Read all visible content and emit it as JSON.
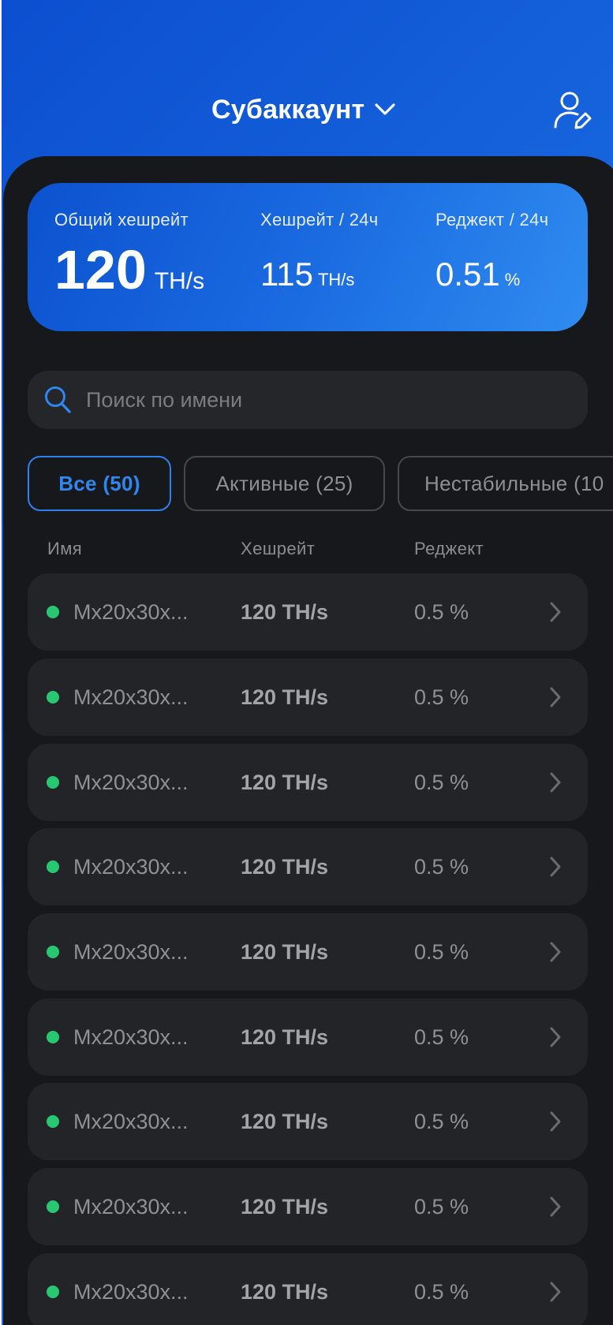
{
  "header": {
    "title": "Субаккаунт"
  },
  "stats": {
    "total": {
      "label": "Общий хешрейт",
      "value": "120",
      "unit": "TH/s"
    },
    "hashrate24": {
      "label": "Хешрейт / 24ч",
      "value": "115",
      "unit": "TH/s"
    },
    "reject24": {
      "label": "Реджект / 24ч",
      "value": "0.51",
      "unit": "%"
    }
  },
  "search": {
    "placeholder": "Поиск по имени"
  },
  "tabs": [
    {
      "label": "Все (50)",
      "active": true
    },
    {
      "label": "Активные (25)",
      "active": false
    },
    {
      "label": "Нестабильные (10",
      "active": false
    }
  ],
  "columns": {
    "name": "Имя",
    "hashrate": "Хешрейт",
    "reject": "Реджект"
  },
  "workers": [
    {
      "name": "Mx20x30x...",
      "hashrate": "120 TH/s",
      "reject": "0.5 %",
      "status_color": "#28c872"
    },
    {
      "name": "Mx20x30x...",
      "hashrate": "120 TH/s",
      "reject": "0.5 %",
      "status_color": "#28c872"
    },
    {
      "name": "Mx20x30x...",
      "hashrate": "120 TH/s",
      "reject": "0.5 %",
      "status_color": "#28c872"
    },
    {
      "name": "Mx20x30x...",
      "hashrate": "120 TH/s",
      "reject": "0.5 %",
      "status_color": "#28c872"
    },
    {
      "name": "Mx20x30x...",
      "hashrate": "120 TH/s",
      "reject": "0.5 %",
      "status_color": "#28c872"
    },
    {
      "name": "Mx20x30x...",
      "hashrate": "120 TH/s",
      "reject": "0.5 %",
      "status_color": "#28c872"
    },
    {
      "name": "Mx20x30x...",
      "hashrate": "120 TH/s",
      "reject": "0.5 %",
      "status_color": "#28c872"
    },
    {
      "name": "Mx20x30x...",
      "hashrate": "120 TH/s",
      "reject": "0.5 %",
      "status_color": "#28c872"
    },
    {
      "name": "Mx20x30x...",
      "hashrate": "120 TH/s",
      "reject": "0.5 %",
      "status_color": "#28c872"
    }
  ],
  "icons": {
    "title_chevron": "chevron-down-icon",
    "profile": "user-edit-icon",
    "search": "search-icon",
    "row_chevron": "chevron-right-icon"
  },
  "colors": {
    "accent": "#2f82ec",
    "status_active": "#28c872",
    "panel_bg": "#17181b",
    "row_bg": "#232428"
  }
}
